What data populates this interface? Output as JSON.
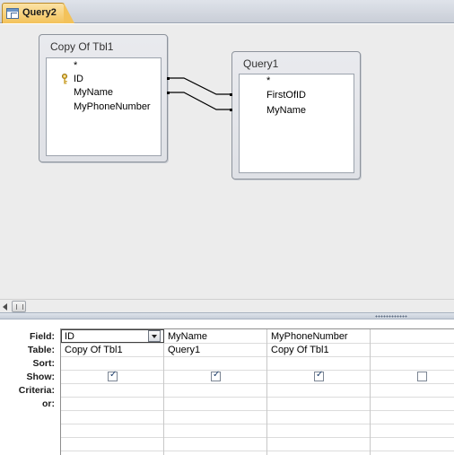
{
  "tab": {
    "label": "Query2",
    "icon": "query-object-icon"
  },
  "tables": [
    {
      "title": "Copy Of Tbl1",
      "fields": [
        "*",
        "ID",
        "MyName",
        "MyPhoneNumber"
      ],
      "primary_key": "ID"
    },
    {
      "title": "Query1",
      "fields": [
        "*",
        "FirstOfID",
        "MyName"
      ]
    }
  ],
  "grid": {
    "row_labels": [
      "Field:",
      "Table:",
      "Sort:",
      "Show:",
      "Criteria:",
      "or:"
    ],
    "columns": [
      {
        "field": "ID",
        "table": "Copy Of Tbl1",
        "show": true
      },
      {
        "field": "MyName",
        "table": "Query1",
        "show": true
      },
      {
        "field": "MyPhoneNumber",
        "table": "Copy Of Tbl1",
        "show": true
      },
      {
        "field": "",
        "table": "",
        "show": false
      }
    ]
  },
  "colors": {
    "tab_active": "#f3c25a",
    "pane_background": "#ececec",
    "join_line": "#000000"
  }
}
